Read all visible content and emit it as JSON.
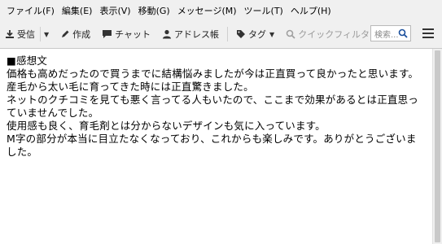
{
  "menu": [
    {
      "label": "ファイル(F)"
    },
    {
      "label": "編集(E)"
    },
    {
      "label": "表示(V)"
    },
    {
      "label": "移動(G)"
    },
    {
      "label": "メッセージ(M)"
    },
    {
      "label": "ツール(T)"
    },
    {
      "label": "ヘルプ(H)"
    }
  ],
  "toolbar": {
    "receive_label": "受信",
    "compose_label": "作成",
    "chat_label": "チャット",
    "addressbook_label": "アドレス帳",
    "tag_label": "タグ",
    "quickfilter_label": "クイックフィルタ",
    "search_placeholder": "検索..."
  },
  "message": {
    "lines": [
      "■感想文",
      "価格も高めだったので買うまでに結構悩みましたが今は正直買って良かったと思います。",
      "産毛から太い毛に育ってきた時には正直驚きました。",
      "ネットのクチコミを見ても悪く言ってる人もいたので、ここまで効果があるとは正直思っていませんでした。",
      "使用感も良く、育毛剤とは分からないデザインも気に入っています。",
      "M字の部分が本当に目立たなくなっており、これからも楽しみです。ありがとうございました。"
    ]
  }
}
